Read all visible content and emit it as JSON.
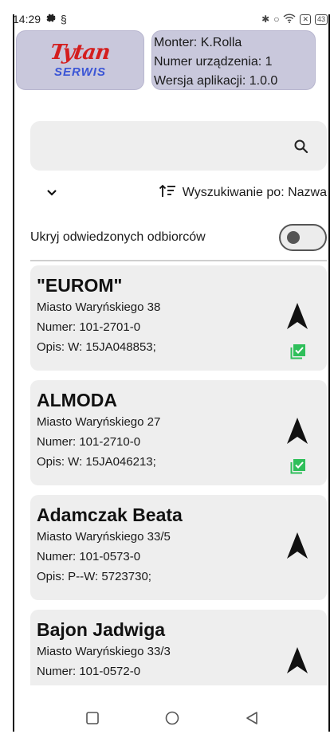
{
  "status_bar": {
    "time": "14:29",
    "icons_left": [
      "gear-icon",
      "sync-icon"
    ],
    "icons_right": [
      "bluetooth-icon",
      "location-icon",
      "wifi-icon",
      "x-icon",
      "battery-icon"
    ],
    "battery_level": "43"
  },
  "header": {
    "logo_top": "Tytan",
    "logo_bottom": "SERWIS",
    "monter": "Monter: K.Rolla",
    "device": "Numer urządzenia: 1",
    "version": "Wersja aplikacji: 1.0.0"
  },
  "search": {
    "value": "",
    "icon": "search-icon"
  },
  "sort": {
    "label": "Wyszukiwanie po: Nazwa",
    "icon": "sort-icon",
    "expand_icon": "chevron-down-icon"
  },
  "filter": {
    "label": "Ukryj odwiedzonych odbiorców",
    "enabled": false
  },
  "items": [
    {
      "name": "\"EUROM\"",
      "address": "Miasto Waryńskiego 38",
      "number": "Numer: 101-2701-0",
      "description": "Opis: W: 15JA048853;",
      "visited": true
    },
    {
      "name": "ALMODA",
      "address": "Miasto Waryńskiego 27",
      "number": "Numer: 101-2710-0",
      "description": "Opis: W: 15JA046213;",
      "visited": true
    },
    {
      "name": "Adamczak Beata",
      "address": "Miasto Waryńskiego 33/5",
      "number": "Numer: 101-0573-0",
      "description": "Opis: P--W: 5723730;",
      "visited": false
    },
    {
      "name": "Bajon Jadwiga",
      "address": "Miasto Waryńskiego 33/3",
      "number": "Numer: 101-0572-0",
      "description": "",
      "visited": false
    }
  ],
  "nav_bar": [
    "square-icon",
    "circle-icon",
    "back-triangle-icon"
  ],
  "colors": {
    "header_bg": "#c9c8dc",
    "logo_red": "#d41e1e",
    "logo_blue": "#3a55d6",
    "card_bg": "#eeeeee",
    "visited_green": "#2fbf5a"
  }
}
